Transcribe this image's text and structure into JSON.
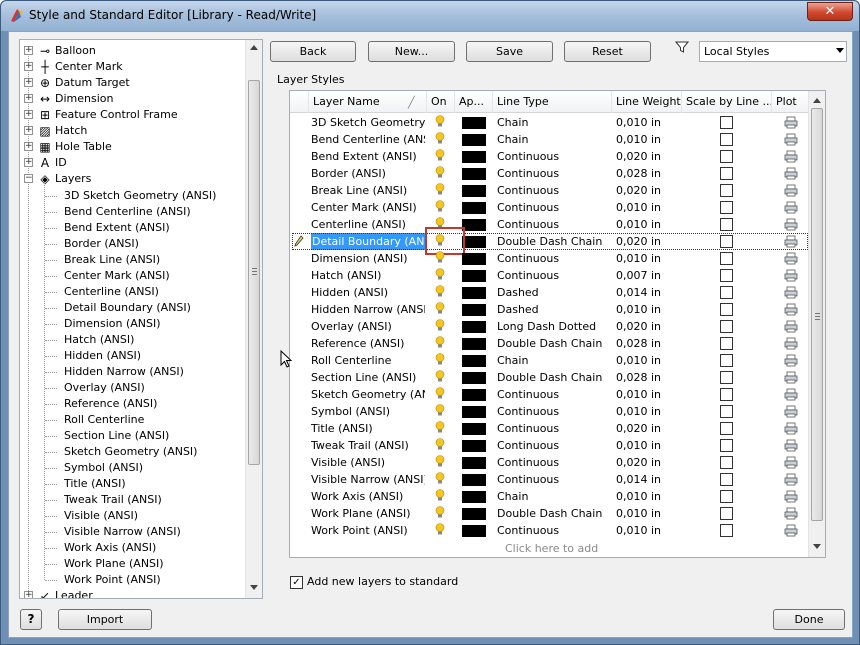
{
  "window": {
    "title": "Style and Standard Editor [Library - Read/Write]",
    "close_glyph": "✕"
  },
  "tree": {
    "items": [
      {
        "label": "Balloon",
        "icon": "balloon-icon",
        "glyph": "⊸",
        "expander": "+"
      },
      {
        "label": "Center Mark",
        "icon": "center-mark-icon",
        "glyph": "┼",
        "expander": "+"
      },
      {
        "label": "Datum Target",
        "icon": "datum-target-icon",
        "glyph": "⊕",
        "expander": "+"
      },
      {
        "label": "Dimension",
        "icon": "dimension-icon",
        "glyph": "↔",
        "expander": "+"
      },
      {
        "label": "Feature Control Frame",
        "icon": "feature-control-frame-icon",
        "glyph": "⊞",
        "expander": "+"
      },
      {
        "label": "Hatch",
        "icon": "hatch-icon",
        "glyph": "▨",
        "expander": "+"
      },
      {
        "label": "Hole Table",
        "icon": "hole-table-icon",
        "glyph": "▦",
        "expander": "+"
      },
      {
        "label": "ID",
        "icon": "id-icon",
        "glyph": "A",
        "expander": "+"
      },
      {
        "label": "Layers",
        "icon": "layers-icon",
        "glyph": "◈",
        "expander": "−"
      }
    ],
    "children": [
      "3D Sketch Geometry (ANSI)",
      "Bend Centerline (ANSI)",
      "Bend Extent (ANSI)",
      "Border (ANSI)",
      "Break Line (ANSI)",
      "Center Mark (ANSI)",
      "Centerline (ANSI)",
      "Detail Boundary (ANSI)",
      "Dimension (ANSI)",
      "Hatch (ANSI)",
      "Hidden (ANSI)",
      "Hidden Narrow (ANSI)",
      "Overlay (ANSI)",
      "Reference (ANSI)",
      "Roll Centerline",
      "Section Line (ANSI)",
      "Sketch Geometry (ANSI)",
      "Symbol (ANSI)",
      "Title (ANSI)",
      "Tweak Trail (ANSI)",
      "Visible (ANSI)",
      "Visible Narrow (ANSI)",
      "Work Axis (ANSI)",
      "Work Plane (ANSI)",
      "Work Point (ANSI)"
    ],
    "after": {
      "label": "Leader",
      "icon": "leader-icon",
      "glyph": "↙",
      "expander": "+"
    }
  },
  "toolbar": {
    "back": "Back",
    "new": "New...",
    "save": "Save",
    "reset": "Reset",
    "filter_icon": "filter-icon",
    "style_filter": "Local Styles"
  },
  "layer_styles": {
    "group_label": "Layer Styles",
    "columns": [
      "Layer Name",
      "On",
      "Ap...",
      "Line Type",
      "Line Weight",
      "Scale by Line ...",
      "Plot"
    ],
    "rows": [
      {
        "name": "3D Sketch Geometry (ANSI)",
        "line_type": "Chain",
        "weight": "0,010 in"
      },
      {
        "name": "Bend Centerline (ANSI)",
        "line_type": "Chain",
        "weight": "0,010 in"
      },
      {
        "name": "Bend Extent (ANSI)",
        "line_type": "Continuous",
        "weight": "0,020 in"
      },
      {
        "name": "Border (ANSI)",
        "line_type": "Continuous",
        "weight": "0,028 in"
      },
      {
        "name": "Break Line (ANSI)",
        "line_type": "Continuous",
        "weight": "0,020 in"
      },
      {
        "name": "Center Mark (ANSI)",
        "line_type": "Continuous",
        "weight": "0,010 in"
      },
      {
        "name": "Centerline (ANSI)",
        "line_type": "Continuous",
        "weight": "0,010 in"
      },
      {
        "name": "Detail Boundary (ANSI)",
        "line_type": "Double Dash Chain",
        "weight": "0,020 in"
      },
      {
        "name": "Dimension (ANSI)",
        "line_type": "Continuous",
        "weight": "0,010 in"
      },
      {
        "name": "Hatch (ANSI)",
        "line_type": "Continuous",
        "weight": "0,007 in"
      },
      {
        "name": "Hidden (ANSI)",
        "line_type": "Dashed",
        "weight": "0,014 in"
      },
      {
        "name": "Hidden Narrow (ANSI)",
        "line_type": "Dashed",
        "weight": "0,010 in"
      },
      {
        "name": "Overlay (ANSI)",
        "line_type": "Long Dash Dotted",
        "weight": "0,020 in"
      },
      {
        "name": "Reference (ANSI)",
        "line_type": "Double Dash Chain",
        "weight": "0,028 in"
      },
      {
        "name": "Roll Centerline",
        "line_type": "Chain",
        "weight": "0,010 in"
      },
      {
        "name": "Section Line (ANSI)",
        "line_type": "Double Dash Chain",
        "weight": "0,028 in"
      },
      {
        "name": "Sketch Geometry (ANSI)",
        "line_type": "Continuous",
        "weight": "0,010 in"
      },
      {
        "name": "Symbol (ANSI)",
        "line_type": "Continuous",
        "weight": "0,010 in"
      },
      {
        "name": "Title (ANSI)",
        "line_type": "Continuous",
        "weight": "0,020 in"
      },
      {
        "name": "Tweak Trail (ANSI)",
        "line_type": "Continuous",
        "weight": "0,010 in"
      },
      {
        "name": "Visible (ANSI)",
        "line_type": "Continuous",
        "weight": "0,020 in"
      },
      {
        "name": "Visible Narrow (ANSI)",
        "line_type": "Continuous",
        "weight": "0,014 in"
      },
      {
        "name": "Work Axis (ANSI)",
        "line_type": "Chain",
        "weight": "0,010 in"
      },
      {
        "name": "Work Plane (ANSI)",
        "line_type": "Double Dash Chain",
        "weight": "0,010 in"
      },
      {
        "name": "Work Point (ANSI)",
        "line_type": "Continuous",
        "weight": "0,010 in"
      }
    ],
    "selected_row": 7,
    "add_row_text": "Click here to add"
  },
  "options": {
    "add_to_standard_label": "Add new layers to standard",
    "add_to_standard_checked": "✓"
  },
  "footer": {
    "help": "?",
    "import": "Import",
    "done": "Done"
  },
  "colors": {
    "accent": "#3399ff",
    "bulb": "#f3c620",
    "highlight_box": "#c0392b"
  }
}
